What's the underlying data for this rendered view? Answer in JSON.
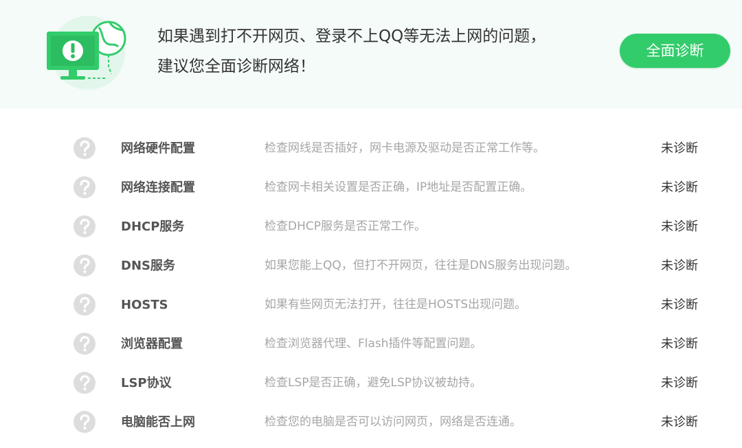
{
  "header": {
    "message_line1": "如果遇到打不开网页、登录不上QQ等无法上网的问题，",
    "message_line2": "建议您全面诊断网络！",
    "diagnose_button_label": "全面诊断",
    "illustration_icon": "computer-warning-globe-icon"
  },
  "colors": {
    "accent": "#33cc6b",
    "header_background": "#f4fbf8",
    "pending_icon": "#dddddd"
  },
  "items": [
    {
      "name": "网络硬件配置",
      "description": "检查网线是否插好，网卡电源及驱动是否正常工作等。",
      "status": "未诊断",
      "icon": "question-icon"
    },
    {
      "name": "网络连接配置",
      "description": "检查网卡相关设置是否正确，IP地址是否配置正确。",
      "status": "未诊断",
      "icon": "question-icon"
    },
    {
      "name": "DHCP服务",
      "description": "检查DHCP服务是否正常工作。",
      "status": "未诊断",
      "icon": "question-icon"
    },
    {
      "name": "DNS服务",
      "description": "如果您能上QQ，但打不开网页，往往是DNS服务出现问题。",
      "status": "未诊断",
      "icon": "question-icon"
    },
    {
      "name": "HOSTS",
      "description": "如果有些网页无法打开，往往是HOSTS出现问题。",
      "status": "未诊断",
      "icon": "question-icon"
    },
    {
      "name": "浏览器配置",
      "description": "检查浏览器代理、Flash插件等配置问题。",
      "status": "未诊断",
      "icon": "question-icon"
    },
    {
      "name": "LSP协议",
      "description": "检查LSP是否正确，避免LSP协议被劫持。",
      "status": "未诊断",
      "icon": "question-icon"
    },
    {
      "name": "电脑能否上网",
      "description": "检查您的电脑是否可以访问网页，网络是否连通。",
      "status": "未诊断",
      "icon": "question-icon"
    }
  ]
}
